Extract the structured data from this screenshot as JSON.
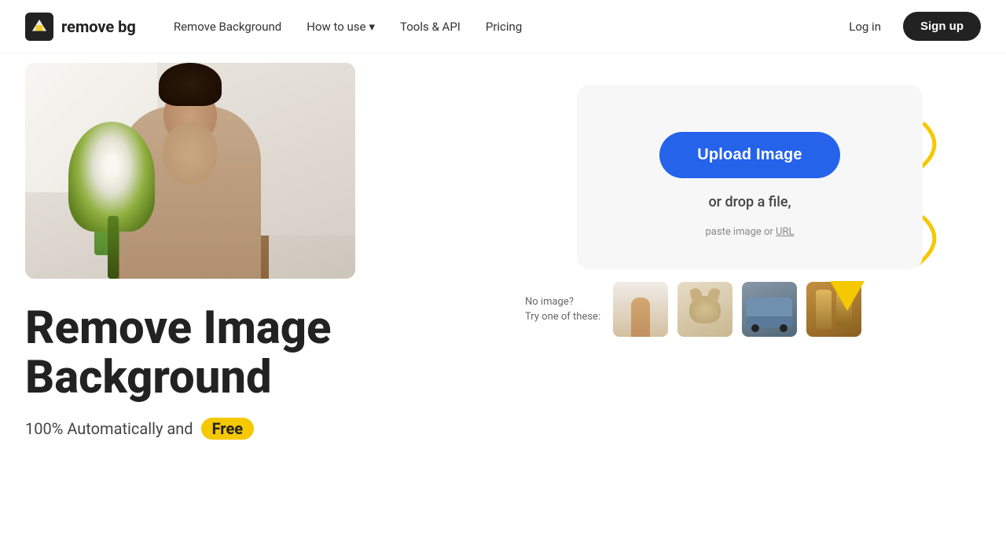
{
  "nav": {
    "logo_text": "remove bg",
    "links": [
      {
        "label": "Remove Background",
        "has_dropdown": false
      },
      {
        "label": "How to use",
        "has_dropdown": true
      },
      {
        "label": "Tools & API",
        "has_dropdown": false
      },
      {
        "label": "Pricing",
        "has_dropdown": false
      }
    ],
    "login_label": "Log in",
    "signup_label": "Sign up"
  },
  "hero": {
    "headline_line1": "Remove Image",
    "headline_line2": "Background",
    "subline_text": "100% Automatically and",
    "free_badge": "Free"
  },
  "upload": {
    "button_label": "Upload Image",
    "drop_text": "or drop a file,",
    "paste_text": "paste image or",
    "url_label": "URL"
  },
  "samples": {
    "no_image_line1": "No image?",
    "no_image_line2": "Try one of these:",
    "thumbs": [
      {
        "label": "person",
        "color": "thumb-person"
      },
      {
        "label": "dog",
        "color": "thumb-dog"
      },
      {
        "label": "car",
        "color": "thumb-car"
      },
      {
        "label": "bottle",
        "color": "thumb-bottle"
      }
    ]
  }
}
